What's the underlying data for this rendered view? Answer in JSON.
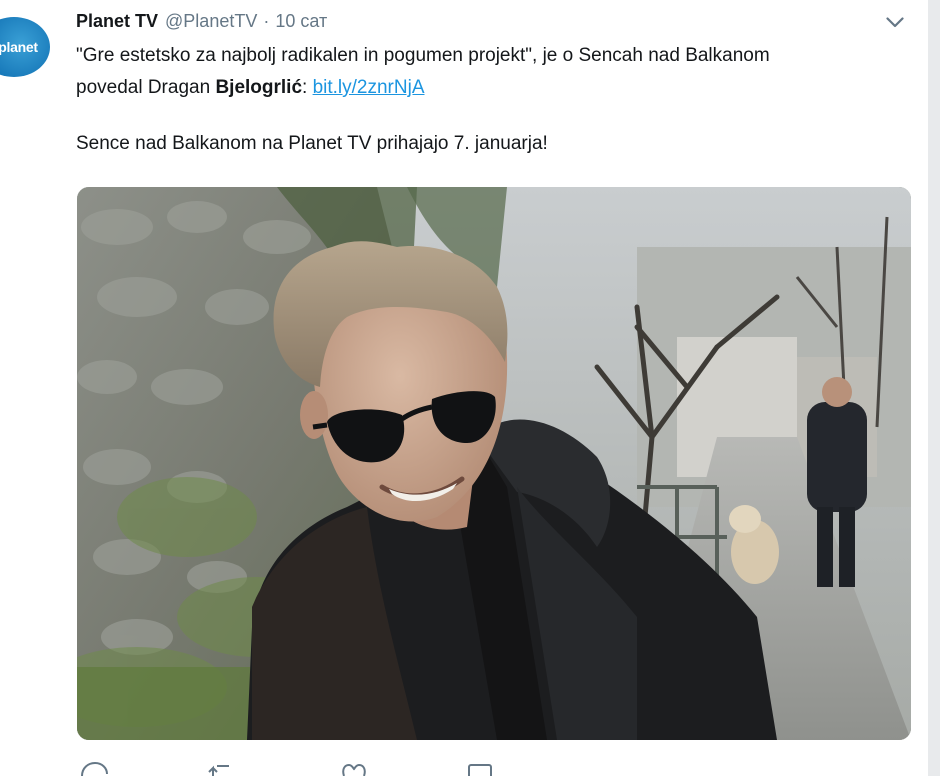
{
  "tweet": {
    "avatar_text": "planet",
    "author_name": "Planet TV",
    "author_handle": "@PlanetTV",
    "separator": "·",
    "time": "10 сат",
    "text": {
      "line1": "\"Gre estetsko za najbolj radikalen in pogumen projekt\", je o Sencah nad Balkanom",
      "line2_prefix": "povedal Dragan ",
      "line2_bold": "Bjelogrlić",
      "line2_colon": ": ",
      "link": "bit.ly/2znrNjA",
      "line3": "Sence nad Balkanom na Planet TV prihajajo 7. januarja!"
    },
    "menu_icon": "chevron-down-icon",
    "media_icon": "photo",
    "actions": [
      "reply-icon",
      "retweet-icon",
      "like-icon",
      "message-icon"
    ]
  },
  "colors": {
    "link": "#1b95e0",
    "secondary_text": "#657786",
    "brand": "#1677b8"
  }
}
